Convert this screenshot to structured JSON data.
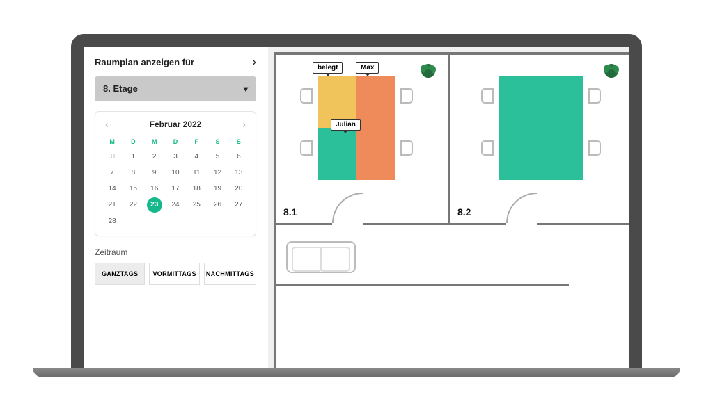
{
  "sidebar": {
    "title": "Raumplan anzeigen für",
    "floor_selected": "8. Etage",
    "zeitraum_label": "Zeitraum",
    "zeit_options": [
      "GANZTAGS",
      "VORMITTAGS",
      "NACHMITTAGS"
    ],
    "zeit_selected": 0
  },
  "calendar": {
    "month_label": "Februar 2022",
    "dow": [
      "M",
      "D",
      "M",
      "D",
      "F",
      "S",
      "S"
    ],
    "lead_days": [
      31
    ],
    "days": [
      1,
      2,
      3,
      4,
      5,
      6,
      7,
      8,
      9,
      10,
      11,
      12,
      13,
      14,
      15,
      16,
      17,
      18,
      19,
      20,
      21,
      22,
      23,
      24,
      25,
      26,
      27,
      28
    ],
    "selected": 23
  },
  "floorplan": {
    "rooms": [
      {
        "id": "8.1",
        "label": "8.1",
        "desks": [
          {
            "pos": "TL",
            "status": "belegt",
            "color": "yellow",
            "tag": "belegt"
          },
          {
            "pos": "TR",
            "status": "booked",
            "color": "orange",
            "user": "Max"
          },
          {
            "pos": "BL",
            "status": "free",
            "color": "teal"
          },
          {
            "pos": "BR",
            "status": "booked",
            "color": "orange",
            "user": "Julian"
          }
        ]
      },
      {
        "id": "8.2",
        "label": "8.2",
        "desks": [
          {
            "pos": "TL",
            "status": "free",
            "color": "teal"
          },
          {
            "pos": "TR",
            "status": "free",
            "color": "teal"
          },
          {
            "pos": "BL",
            "status": "free",
            "color": "teal"
          },
          {
            "pos": "BR",
            "status": "free",
            "color": "teal"
          }
        ]
      }
    ],
    "tags": {
      "belegt": "belegt",
      "max": "Max",
      "julian": "Julian"
    },
    "colors": {
      "free": "#2bbf9a",
      "belegt": "#f0c45a",
      "booked": "#ef8b5a"
    }
  }
}
